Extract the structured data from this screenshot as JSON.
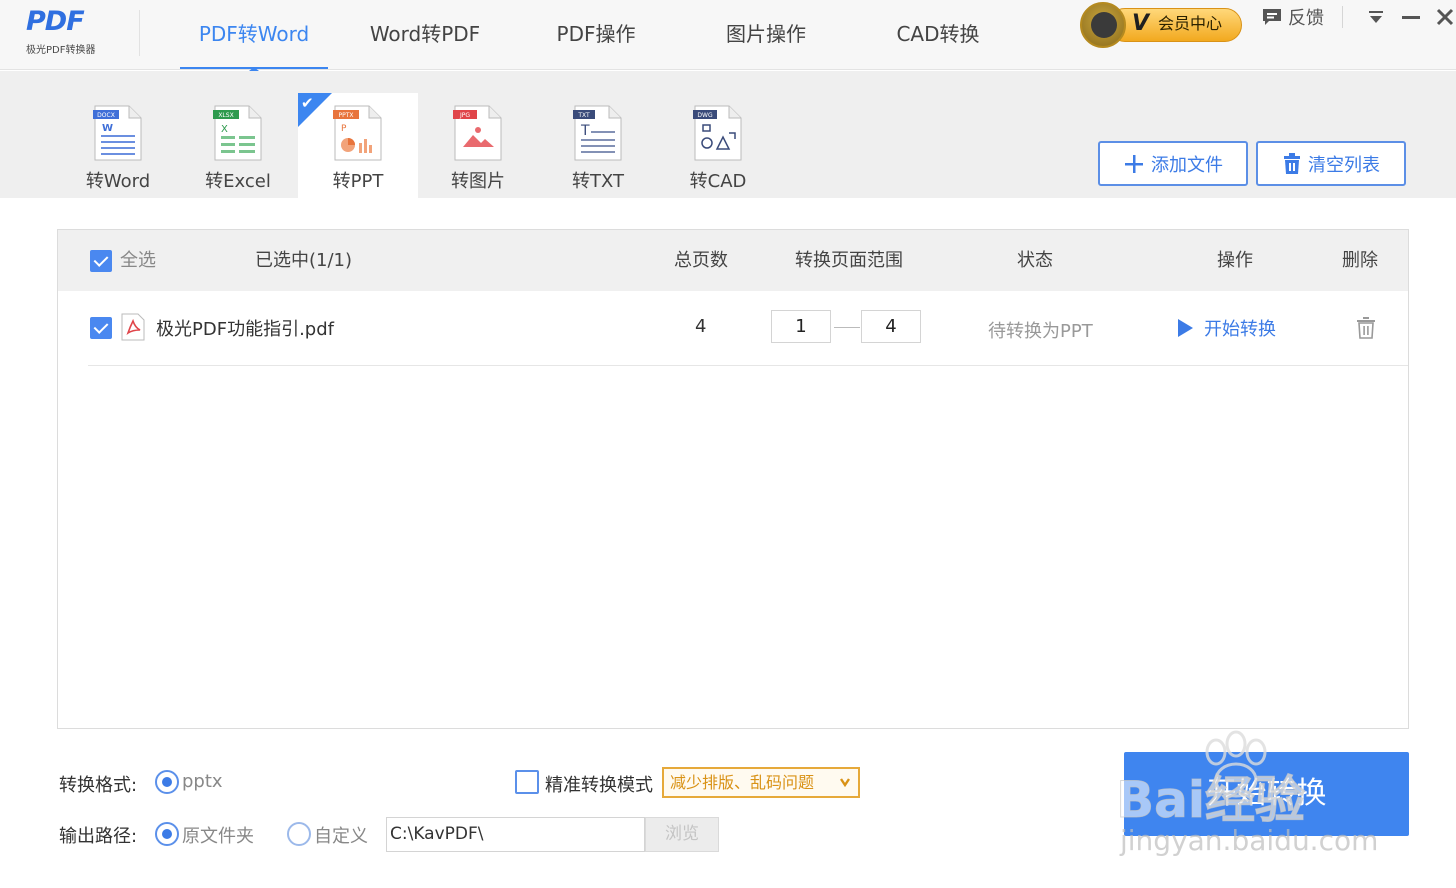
{
  "app": {
    "logo_mark": "PDF",
    "logo_sub": "极光PDF转换器"
  },
  "nav": {
    "tabs": [
      {
        "label": "PDF转Word",
        "active": true
      },
      {
        "label": "Word转PDF",
        "active": false
      },
      {
        "label": "PDF操作",
        "active": false
      },
      {
        "label": "图片操作",
        "active": false
      },
      {
        "label": "CAD转换",
        "active": false
      }
    ],
    "vip_label": "会员中心",
    "vip_badge": "V",
    "feedback_label": "反馈"
  },
  "tools": [
    {
      "label": "转Word",
      "tag": "DOCX",
      "tag_color": "#3f6fd8",
      "icon": "word-doc-icon",
      "active": false
    },
    {
      "label": "转Excel",
      "tag": "XLSX",
      "tag_color": "#2e9a4e",
      "icon": "excel-doc-icon",
      "active": false
    },
    {
      "label": "转PPT",
      "tag": "PPTX",
      "tag_color": "#e8743c",
      "icon": "ppt-doc-icon",
      "active": true
    },
    {
      "label": "转图片",
      "tag": "JPG",
      "tag_color": "#e0454a",
      "icon": "image-doc-icon",
      "active": false
    },
    {
      "label": "转TXT",
      "tag": "TXT",
      "tag_color": "#3a4b7a",
      "icon": "txt-doc-icon",
      "active": false
    },
    {
      "label": "转CAD",
      "tag": "DWG",
      "tag_color": "#3a4b7a",
      "icon": "cad-doc-icon",
      "active": false
    }
  ],
  "actions": {
    "add_file": "添加文件",
    "clear_list": "清空列表"
  },
  "table": {
    "select_all": "全选",
    "selected_count": "已选中(1/1)",
    "headers": {
      "pages": "总页数",
      "range": "转换页面范围",
      "status": "状态",
      "operation": "操作",
      "delete": "删除"
    },
    "rows": [
      {
        "filename": "极光PDF功能指引.pdf",
        "pages": "4",
        "range_from": "1",
        "range_to": "4",
        "status": "待转换为PPT",
        "action": "开始转换"
      }
    ]
  },
  "settings": {
    "format_label": "转换格式:",
    "format_value": "pptx",
    "precise_mode_label": "精准转换模式",
    "precise_mode_hint": "减少排版、乱码问题",
    "output_label": "输出路径:",
    "output_original": "原文件夹",
    "output_custom": "自定义",
    "output_path": "C:\\KavPDF\\",
    "browse": "浏览",
    "start_button": "开始转换"
  },
  "watermark": {
    "brand": "Bai经验",
    "url": "jingyan.baidu.com"
  },
  "colors": {
    "accent": "#3c86f0",
    "vip_gold": "#f2a91f",
    "hint_orange": "#d99216"
  }
}
